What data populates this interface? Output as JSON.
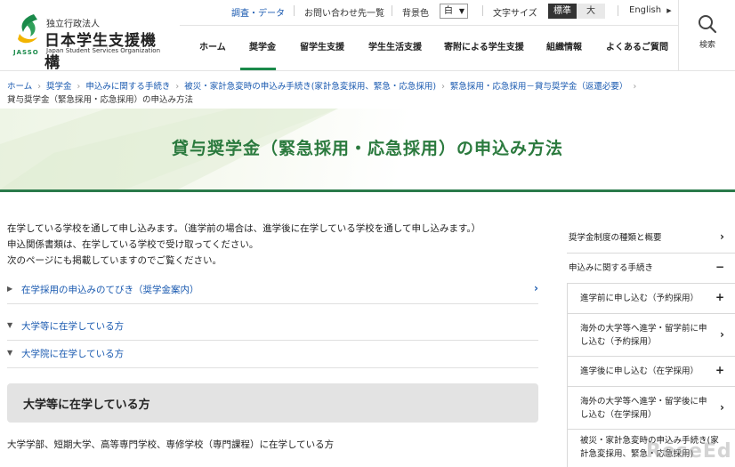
{
  "logo": {
    "small": "独立行政法人",
    "big": "日本学生支援機構",
    "en": "Japan Student Services Organization",
    "mark_text": "JASSO",
    "accent": "#1a8a4a",
    "accent2": "#f2b400"
  },
  "utility": {
    "research": "調査・データ",
    "contact": "お問い合わせ先一覧",
    "bg_label": "背景色",
    "bg_value": "白",
    "font_label": "文字サイズ",
    "size_standard": "標準",
    "size_large": "大",
    "language": "English"
  },
  "gnav": {
    "items": [
      "ホーム",
      "奨学金",
      "留学生支援",
      "学生生活支援",
      "寄附による学生支援",
      "組織情報",
      "よくあるご質問"
    ],
    "active_index": 1
  },
  "search": {
    "label": "検索",
    "icon": "search-icon"
  },
  "breadcrumb": {
    "items": [
      "ホーム",
      "奨学金",
      "申込みに関する手続き",
      "被災・家計急変時の申込み手続き(家計急変採用、緊急・応急採用)",
      "緊急採用・応急採用－貸与奨学金（返還必要）"
    ],
    "current": "貸与奨学金（緊急採用・応急採用）の申込み方法"
  },
  "hero": {
    "title": "貸与奨学金（緊急採用・応急採用）の申込み方法",
    "accent": "#2b7a3e"
  },
  "main": {
    "intro": [
      "在学している学校を通して申し込みます。（進学前の場合は、進学後に在学している学校を通して申し込みます。）",
      "申込関係書類は、在学している学校で受け取ってください。",
      "次のページにも掲載していますのでご覧ください。"
    ],
    "accordion": [
      {
        "label": "在学採用の申込みのてびき（奨学金案内）",
        "marker": "▶",
        "chevron": "›"
      },
      {
        "label": "大学等に在学している方",
        "marker": "▼",
        "chevron": ""
      },
      {
        "label": "大学院に在学している方",
        "marker": "▼",
        "chevron": ""
      }
    ],
    "section_heading": "大学等に在学している方",
    "section_text": "大学学部、短期大学、高等専門学校、専修学校（専門課程）に在学している方"
  },
  "sidebar": {
    "items": [
      {
        "label": "奨学金制度の種類と概要",
        "icon": "›"
      },
      {
        "label": "申込みに関する手続き",
        "icon": "−"
      },
      {
        "label": "進学前に申し込む（予約採用）",
        "icon": "+"
      },
      {
        "label": "海外の大学等へ進学・留学前に申し込む（予約採用）",
        "icon": "›"
      },
      {
        "label": "進学後に申し込む（在学採用）",
        "icon": "+"
      },
      {
        "label": "海外の大学等へ進学・留学後に申し込む（在学採用）",
        "icon": "›"
      },
      {
        "label": "被災・家計急変時の申込み手続き(家計急変採用、緊急・応急採用)",
        "icon": ""
      }
    ]
  },
  "watermark": "ReseEd"
}
